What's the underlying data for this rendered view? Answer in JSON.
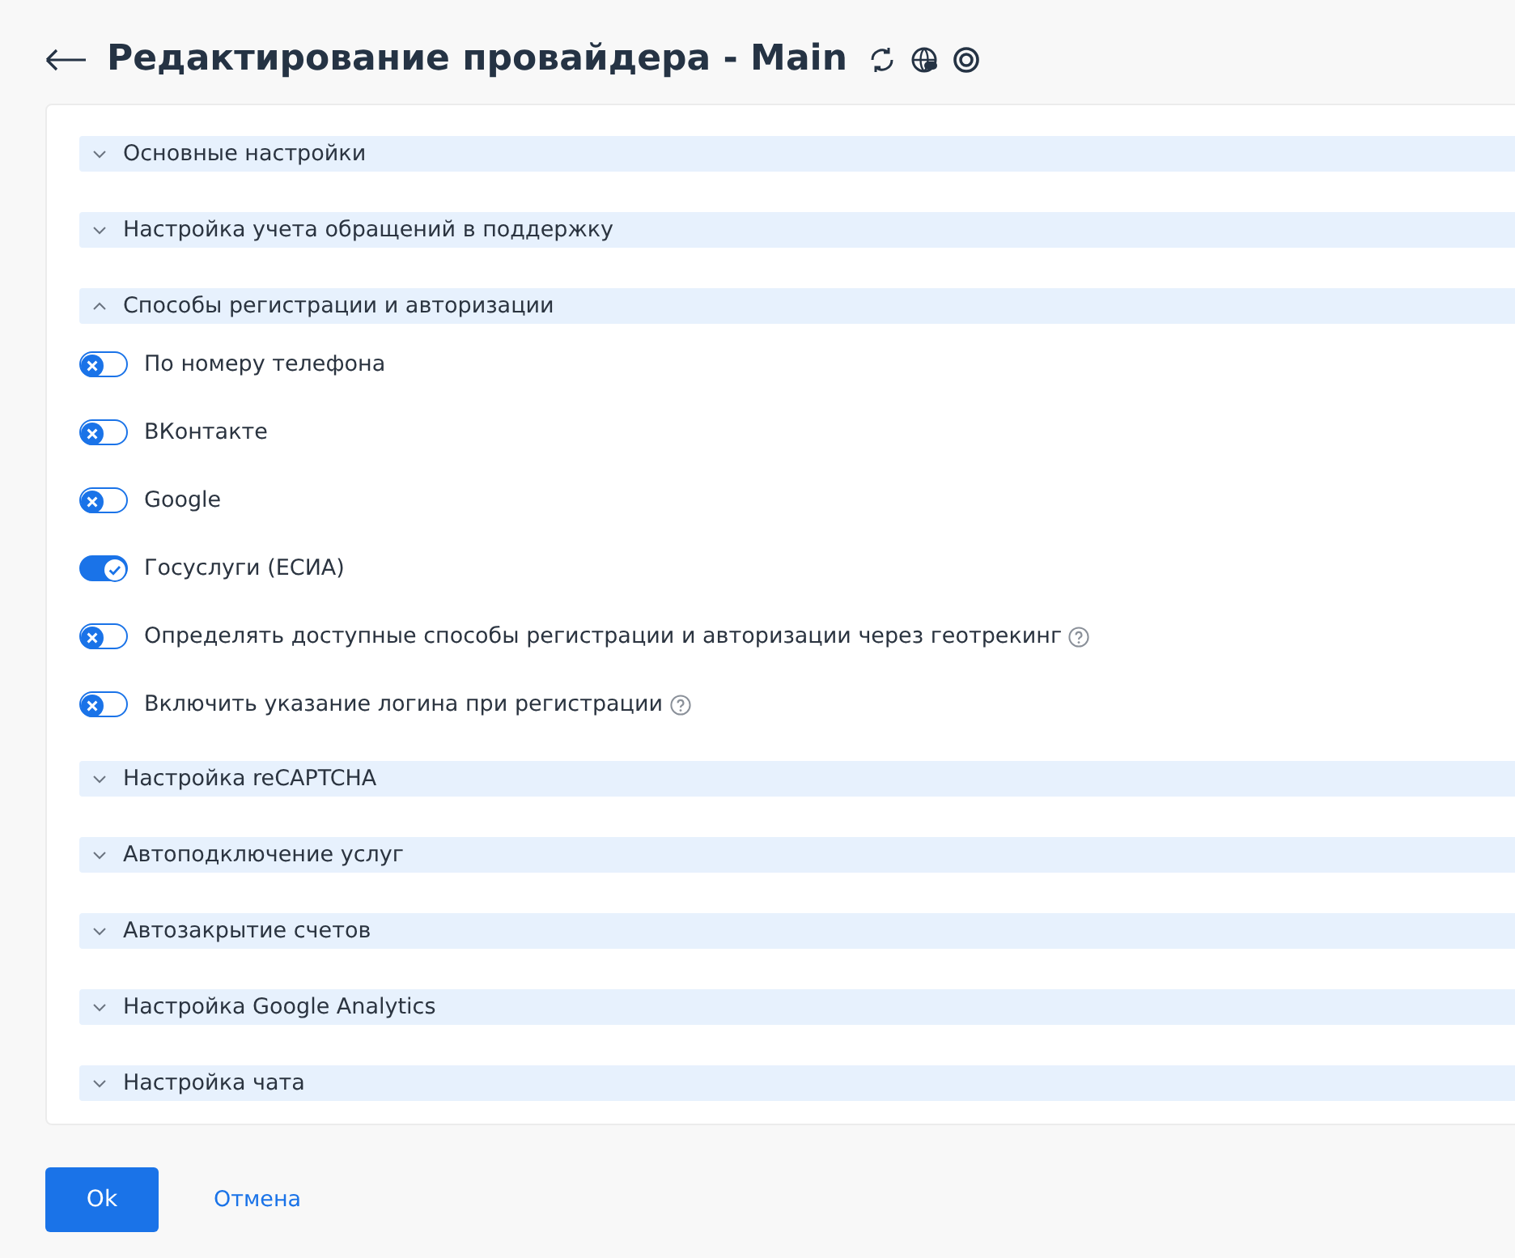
{
  "header": {
    "title": "Редактирование провайдера - Main"
  },
  "sections": [
    {
      "title": "Основные настройки",
      "expanded": false
    },
    {
      "title": "Настройка учета обращений в поддержку",
      "expanded": false
    },
    {
      "title": "Способы регистрации и авторизации",
      "expanded": true,
      "options": [
        {
          "label": "По номеру телефона",
          "on": false,
          "help": false
        },
        {
          "label": "ВКонтакте",
          "on": false,
          "help": false
        },
        {
          "label": "Google",
          "on": false,
          "help": false
        },
        {
          "label": "Госуслуги (ЕСИА)",
          "on": true,
          "help": false
        },
        {
          "label": "Определять доступные способы регистрации и авторизации через геотрекинг",
          "on": false,
          "help": true
        },
        {
          "label": "Включить указание логина при регистрации",
          "on": false,
          "help": true
        }
      ]
    },
    {
      "title": "Настройка reCAPTCHA",
      "expanded": false
    },
    {
      "title": "Автоподключение услуг",
      "expanded": false
    },
    {
      "title": "Автозакрытие счетов",
      "expanded": false
    },
    {
      "title": "Настройка Google Analytics",
      "expanded": false
    },
    {
      "title": "Настройка чата",
      "expanded": false
    }
  ],
  "buttons": {
    "ok": "Ok",
    "cancel": "Отмена"
  }
}
